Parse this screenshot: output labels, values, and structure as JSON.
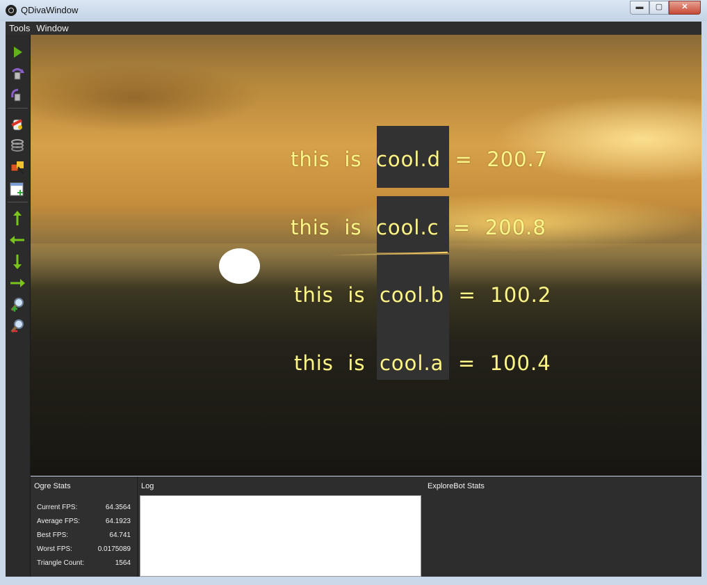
{
  "window": {
    "title": "QDivaWindow",
    "min_label": "▬",
    "max_label": "▢",
    "close_label": "✕"
  },
  "menu": {
    "items": [
      "Tools",
      "Window"
    ]
  },
  "toolbar": {
    "icons": [
      "play-icon",
      "rotate-camera-icon",
      "rotate-camera-reverse-icon",
      "paint-bucket-icon",
      "spring-icon",
      "select-object-icon",
      "add-panel-icon",
      "arrow-up-icon",
      "arrow-left-icon",
      "arrow-down-icon",
      "arrow-right-icon",
      "zoom-in-icon",
      "zoom-out-icon"
    ]
  },
  "viewport": {
    "labels": [
      {
        "prefix": "this  is  ",
        "name": "cool.d",
        "sep": "  =  ",
        "value": "200.7"
      },
      {
        "prefix": "this  is  ",
        "name": "cool.c",
        "sep": "  =  ",
        "value": "200.8"
      },
      {
        "prefix": "this  is  ",
        "name": "cool.b",
        "sep": "  =  ",
        "value": "100.2"
      },
      {
        "prefix": "this  is  ",
        "name": "cool.a",
        "sep": "  =  ",
        "value": "100.4"
      }
    ]
  },
  "ogre_stats": {
    "title": "Ogre Stats",
    "rows": [
      {
        "label": "Current FPS:",
        "value": "64.3564"
      },
      {
        "label": "Average FPS:",
        "value": "64.1923"
      },
      {
        "label": "Best FPS:",
        "value": "64.741"
      },
      {
        "label": "Worst FPS:",
        "value": "0.0175089"
      },
      {
        "label": "Triangle Count:",
        "value": "1564"
      }
    ]
  },
  "log": {
    "title": "Log",
    "content": ""
  },
  "explorebot": {
    "title": "ExploreBot Stats"
  },
  "colors": {
    "overlay_text": "#fff68a",
    "icon_green": "#7bc41e",
    "panel_bg": "#2d2d2d"
  }
}
